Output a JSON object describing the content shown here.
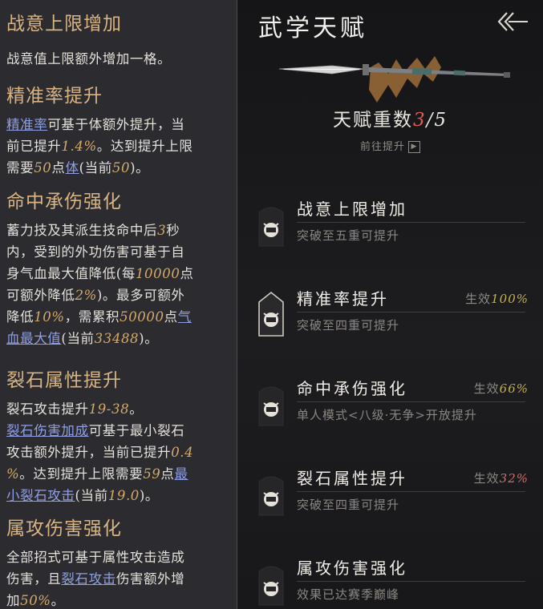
{
  "left": {
    "sections": [
      {
        "title": "战意上限增加"
      },
      {
        "title": "精准率提升"
      },
      {
        "title": "命中承伤强化"
      },
      {
        "title": "裂石属性提升"
      },
      {
        "title": "属攻伤害强化"
      }
    ],
    "s1": {
      "line1": "战意值上限额外增加一格。"
    },
    "s2": {
      "link1": "精准率",
      "t1": "可基于体额外提升，当",
      "t2": "前已提升",
      "n1": "1.4%",
      "t3": "。达到提升上限",
      "t4": "需要",
      "n2": "50",
      "t5": "点",
      "link2": "体",
      "t6": "(当前",
      "n3": "50",
      "t7": ")。"
    },
    "s3": {
      "t1": "蓄力技及其派生技命中后",
      "n1": "3",
      "t2": "秒",
      "t3": "内，受到的外功伤害可基于自",
      "t4": "身气血最大值降低(每",
      "n2": "10000",
      "t5": "点",
      "t6": "可额外降低",
      "n3": "2%",
      "t7": ")。最多可额外",
      "t8": "降低",
      "n4": "10%",
      "t9": "，需累积",
      "n5": "50000",
      "t10": "点",
      "link1": "气",
      "link2": "血最大值",
      "t11": "(当前",
      "n6": "33488",
      "t12": ")。"
    },
    "s4": {
      "t1": "裂石攻击提升",
      "n1": "19-38",
      "t2": "。",
      "link1": "裂石伤害加成",
      "t3": "可基于最小裂石",
      "t4": "攻击额外提升，当前已提升",
      "n2": "0.4",
      "n3": "%",
      "t5": "。达到提升上限需要",
      "n4": "59",
      "t6": "点",
      "link2": "最",
      "link3": "小裂石攻击",
      "t7": "(当前",
      "n5": "19.0",
      "t8": ")。"
    },
    "s5": {
      "t1": "全部招式可基于属性攻击造成",
      "t2": "伤害，且",
      "link1": "裂石攻击",
      "t3": "伤害额外增",
      "t4": "加",
      "n1": "50%",
      "t5": "。"
    }
  },
  "right": {
    "title": "武学天赋",
    "back_icon": "back-arrow-icon",
    "weapon_icon": "spear-icon",
    "level_label": "天赋重数",
    "level_current": "3",
    "level_sep": "/",
    "level_max": "5",
    "goto_label": "前往提升",
    "goto_icon": "arrow-right-box-icon",
    "talents": [
      {
        "name": "战意上限增加",
        "effect_label": "",
        "effect_pct": "",
        "desc": "突破至五重可提升",
        "icon": "fist-emblem-icon"
      },
      {
        "name": "精准率提升",
        "effect_label": "生效",
        "effect_pct": "100%",
        "desc": "突破至四重可提升",
        "icon": "fist-emblem-icon"
      },
      {
        "name": "命中承伤强化",
        "effect_label": "生效",
        "effect_pct": "66%",
        "desc": "单人模式<八级·无争>开放提升",
        "icon": "fist-emblem-icon"
      },
      {
        "name": "裂石属性提升",
        "effect_label": "生效",
        "effect_pct": "32%",
        "desc": "突破至四重可提升",
        "icon": "fist-emblem-icon"
      },
      {
        "name": "属攻伤害强化",
        "effect_label": "",
        "effect_pct": "",
        "desc": "效果已达赛季巅峰",
        "icon": "fist-emblem-icon"
      }
    ],
    "colors": {
      "accent_gold": "#d8b483",
      "current_red": "#e25a52",
      "link_blue": "#8f9fe4",
      "pct_yellow": "#c4b14f",
      "pct_red": "#d76a64"
    }
  }
}
